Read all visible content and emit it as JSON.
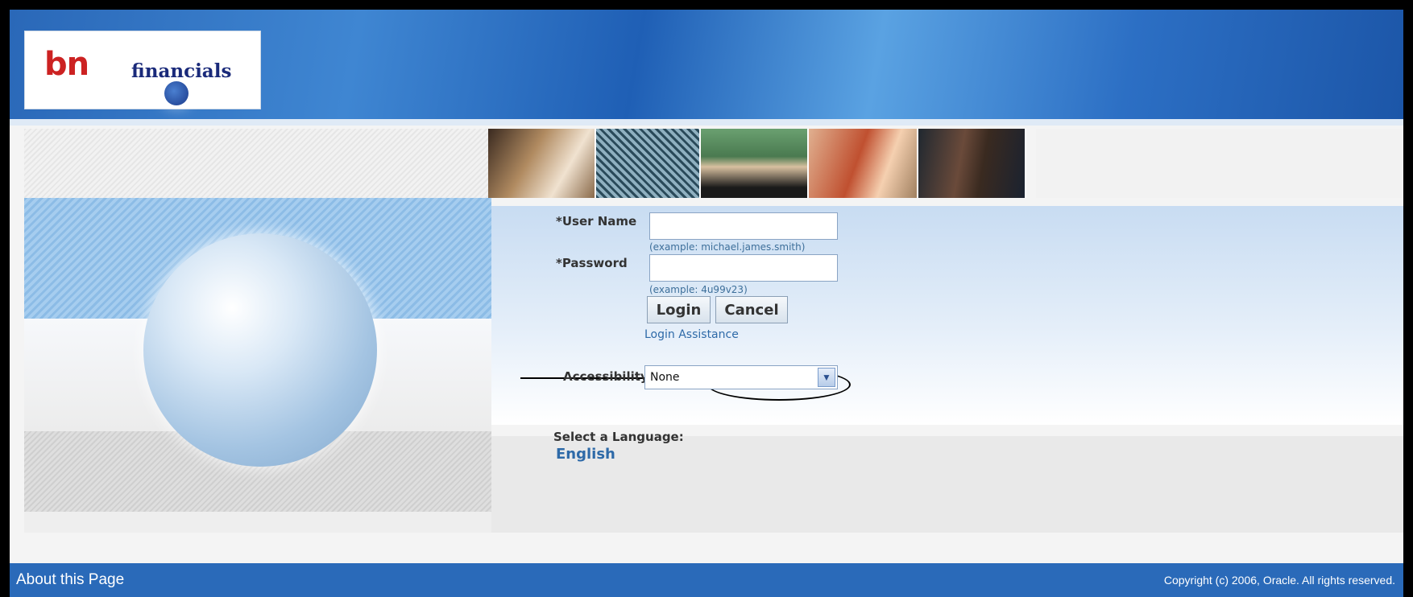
{
  "header": {
    "logo_mark_left": "b",
    "logo_mark_right": "n",
    "logo_text": "financials"
  },
  "login": {
    "username_label": "*User Name",
    "username_value": "",
    "username_hint": "(example: michael.james.smith)",
    "password_label": "*Password",
    "password_value": "",
    "password_hint": "(example: 4u99v23)",
    "login_button": "Login",
    "cancel_button": "Cancel",
    "assistance_link": "Login Assistance",
    "accessibility_label": "Accessibility",
    "accessibility_value": "None"
  },
  "language": {
    "label": "Select a Language:",
    "option": "English"
  },
  "footer": {
    "about": "About this Page",
    "copyright": "Copyright (c) 2006, Oracle. All rights reserved."
  },
  "colors": {
    "header_blue": "#2a68b8",
    "footer_blue": "#2a6ab9",
    "link_blue": "#2e6aa8"
  }
}
